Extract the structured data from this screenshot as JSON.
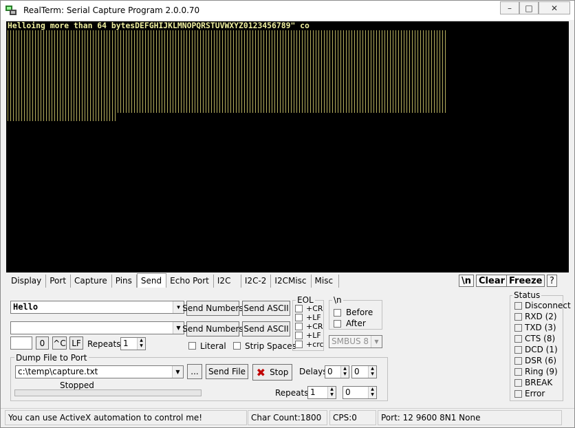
{
  "window": {
    "title": "RealTerm: Serial Capture Program 2.0.0.70",
    "minimize": "▭",
    "maximize": "□",
    "close": "✕"
  },
  "terminal": {
    "line1": "Helloing more than 64 bytesDEFGHIJKLMNOPQRSTUVWXYZ0123456789\" co"
  },
  "tabs": [
    "Display",
    "Port",
    "Capture",
    "Pins",
    "Send",
    "Echo Port",
    "I2C",
    "I2C-2",
    "I2CMisc",
    "Misc"
  ],
  "toolbar": {
    "newline": "\\n",
    "clear": "Clear",
    "freeze": "Freeze",
    "help": "?"
  },
  "send": {
    "input1": "Hello",
    "input2": "",
    "send_numbers1": "Send Numbers",
    "send_ascii1": "Send ASCII",
    "send_numbers2": "Send Numbers",
    "send_ascii2": "Send ASCII",
    "num_field": "",
    "zero_btn": "0",
    "ctrl_c_btn": "^C",
    "lf_btn": "LF",
    "repeats_label": "Repeats",
    "repeats_value": "1",
    "literal": "Literal",
    "strip_spaces": "Strip Spaces"
  },
  "eol": {
    "title": "EOL",
    "cr1": "+CR",
    "lf1": "+LF",
    "cr2": "+CR",
    "lf2": "+LF",
    "crc": "+crc"
  },
  "newline_group": {
    "title": "\\n",
    "before": "Before",
    "after": "After",
    "smbus": "SMBUS 8"
  },
  "dump": {
    "title": "Dump File to Port",
    "file": "c:\\temp\\capture.txt",
    "browse": "...",
    "send_file": "Send File",
    "stop": "Stop",
    "status": "Stopped",
    "delays_label": "Delays",
    "delay1": "0",
    "delay2": "0",
    "repeats_label": "Repeats",
    "repeats1": "1",
    "repeats2": "0"
  },
  "status_group": {
    "title": "Status",
    "items": [
      "Disconnect",
      "RXD (2)",
      "TXD (3)",
      "CTS (8)",
      "DCD (1)",
      "DSR (6)",
      "Ring (9)",
      "BREAK",
      "Error"
    ]
  },
  "statusbar": {
    "message": "You can use ActiveX automation to control me!",
    "char_count": "Char Count:1800",
    "cps": "CPS:0",
    "port": "Port: 12 9600 8N1 None"
  }
}
